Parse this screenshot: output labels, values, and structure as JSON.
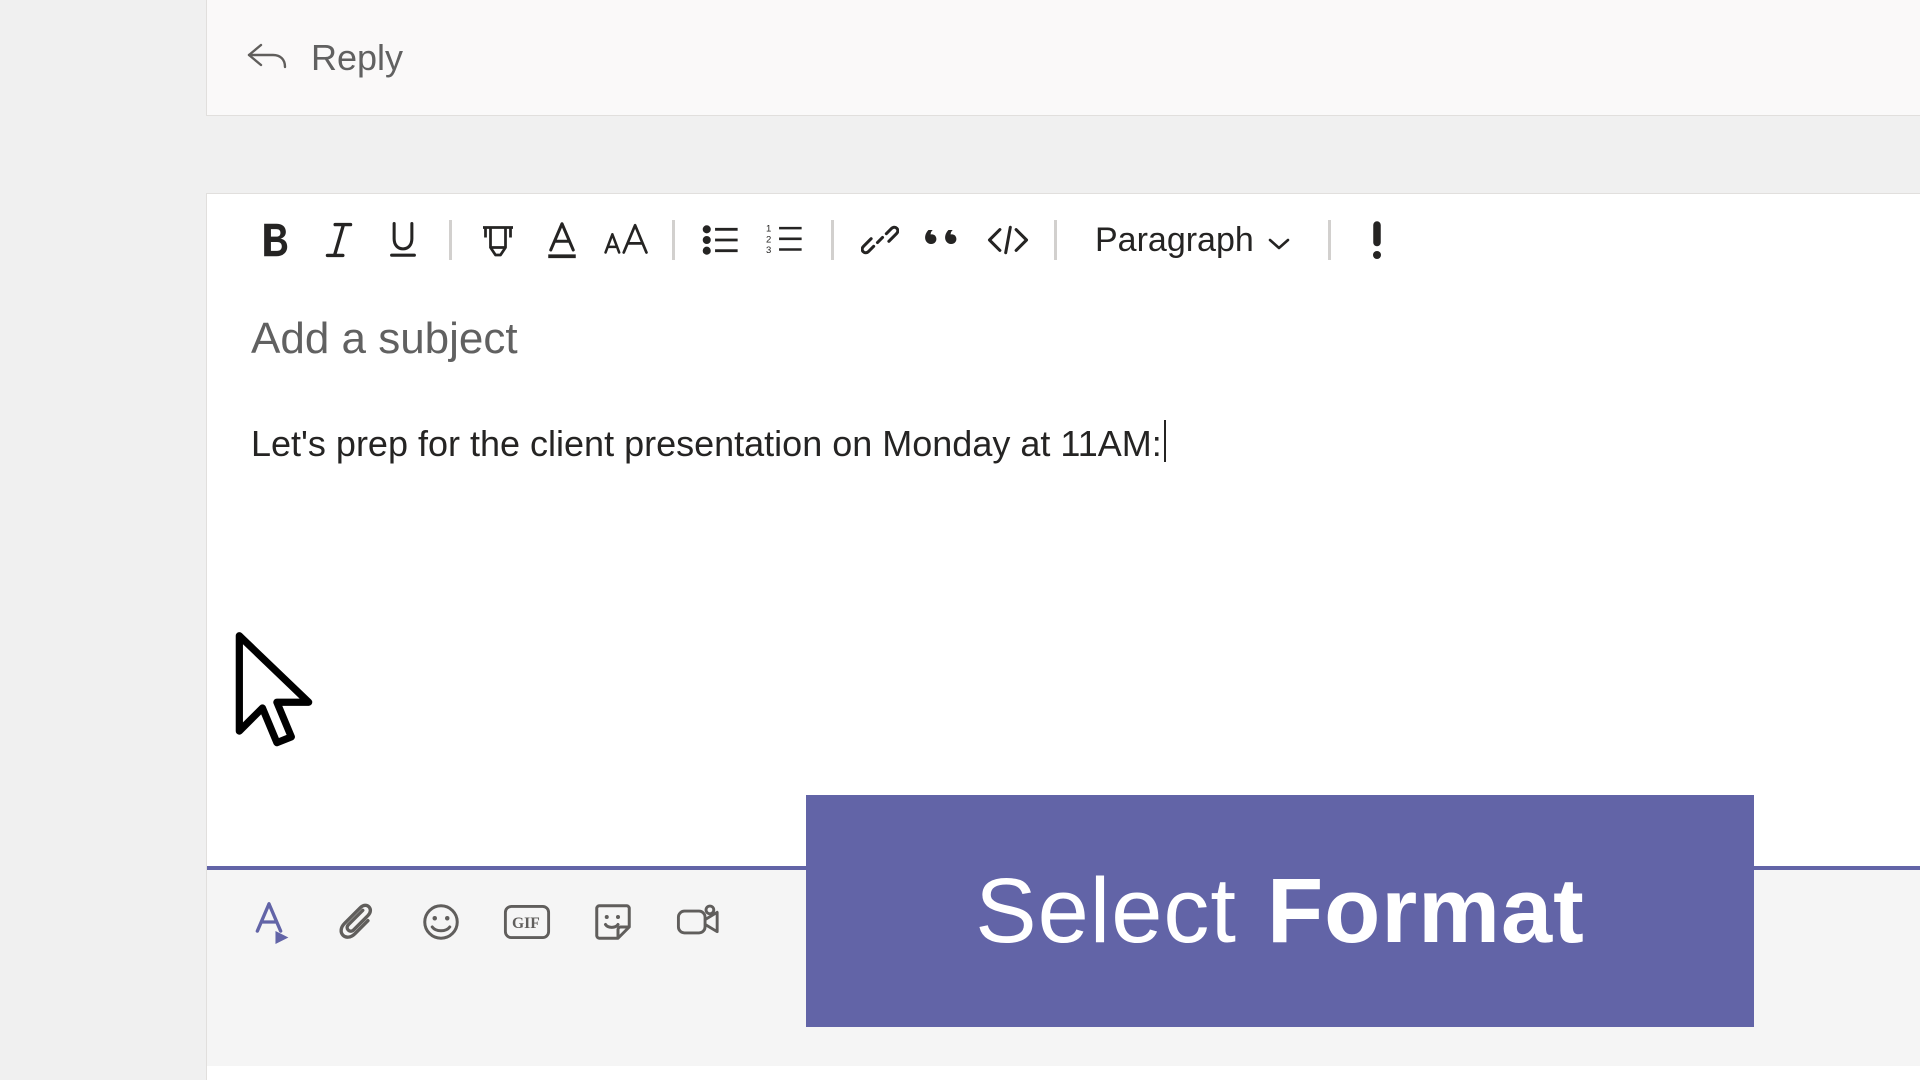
{
  "reply": {
    "label": "Reply"
  },
  "toolbar": {
    "paragraph_label": "Paragraph"
  },
  "compose": {
    "subject_placeholder": "Add a subject",
    "body_text": "Let's prep for the client presentation on Monday at 11AM:"
  },
  "callout": {
    "word1": "Select",
    "word2": "Format"
  }
}
